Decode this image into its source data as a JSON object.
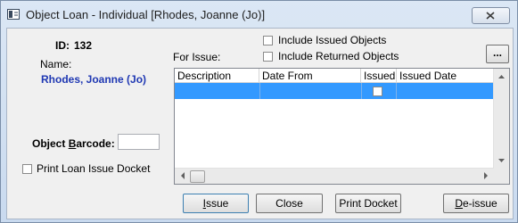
{
  "window": {
    "title": "Object Loan - Individual [Rhodes, Joanne (Jo)]",
    "close_glyph": "✕"
  },
  "left": {
    "id_label": "ID:",
    "id_value": "132",
    "name_label": "Name:",
    "name_value": "Rhodes, Joanne (Jo)",
    "barcode_label_pre": "Object ",
    "barcode_label_mnemonic": "B",
    "barcode_label_post": "arcode:",
    "barcode_value": "",
    "print_docket_label": "Print Loan Issue Docket",
    "print_docket_checked": false
  },
  "right": {
    "for_issue_label": "For Issue:",
    "include_issued_label": "Include Issued Objects",
    "include_issued_checked": false,
    "include_returned_label": "Include Returned Objects",
    "include_returned_checked": false,
    "more_button": "..."
  },
  "grid": {
    "columns": [
      "Description",
      "Date From",
      "Issued",
      "Issued Date"
    ],
    "rows": [
      {
        "description": "",
        "date_from": "",
        "issued": false,
        "issued_date": "",
        "selected": true
      }
    ]
  },
  "buttons": {
    "issue_mnemonic": "I",
    "issue_rest": "ssue",
    "close": "Close",
    "print_docket": "Print Docket",
    "reissue_pre": "D",
    "reissue_rest": "e-issue"
  },
  "colors": {
    "selection": "#3399ff",
    "name_link": "#1f38b3",
    "title_bar": "#c9daef"
  }
}
